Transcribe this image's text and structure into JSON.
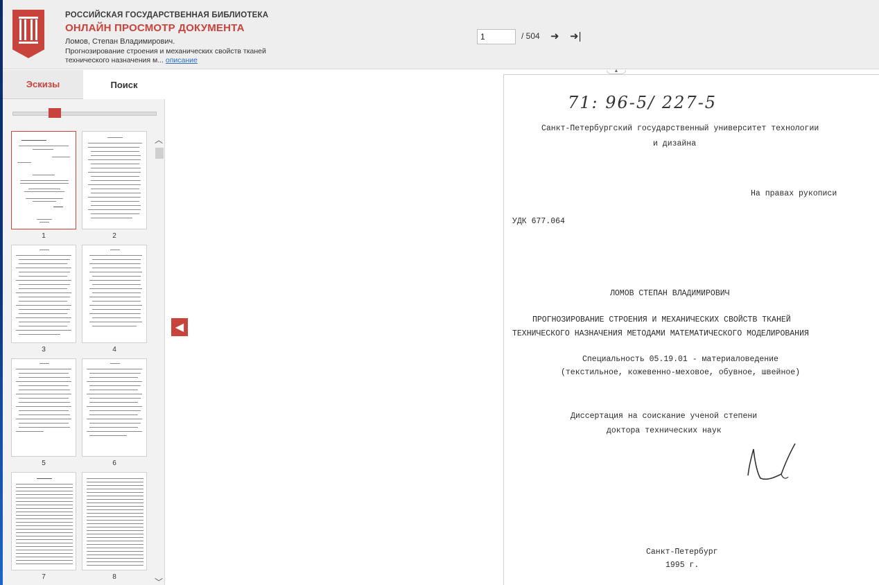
{
  "header": {
    "library_name": "РОССИЙСКАЯ ГОСУДАРСТВЕННАЯ БИБЛИОТЕКА",
    "view_title": "ОНЛАЙН ПРОСМОТР ДОКУМЕНТА",
    "author": "Ломов, Степан Владимирович.",
    "desc_line1": "Прогнозирование строения и механических свойств тканей",
    "desc_line2": "технического назначения м...",
    "desc_link": "описание"
  },
  "pager": {
    "current_page": "1",
    "total": "/ 504",
    "next_icon": "arrow-right-icon",
    "last_icon": "arrow-to-end-icon",
    "next_glyph": "➜",
    "last_glyph": "➜|"
  },
  "sidebar": {
    "tabs": [
      {
        "label": "Эскизы",
        "active": true
      },
      {
        "label": "Поиск",
        "active": false
      }
    ],
    "zoom_level": 0.3,
    "thumbnails": [
      "1",
      "2",
      "3",
      "4",
      "5",
      "6",
      "7",
      "8"
    ]
  },
  "document": {
    "handwritten_code": "71: 96-5/ 227-5",
    "university_line1": "Санкт-Петербургский государственный университет технологии",
    "university_line2": "и дизайна",
    "rights": "На правах рукописи",
    "udk": "УДК 677.064",
    "author_caps": "ЛОМОВ СТЕПАН ВЛАДИМИРОВИЧ",
    "title_line1": "ПРОГНОЗИРОВАНИЕ СТРОЕНИЯ И МЕХАНИЧЕСКИХ СВОЙСТВ ТКАНЕЙ",
    "title_line2": "ТЕХНИЧЕСКОГО НАЗНАЧЕНИЯ МЕТОДАМИ МАТЕМАТИЧЕСКОГО МОДЕЛИРОВАНИЯ",
    "specialty_line1": "Специальность 05.19.01 - материаловедение",
    "specialty_line2": "(текстильное, кожевенно-меховое, обувное, швейное)",
    "dissertation_line1": "Диссертация на соискание ученой степени",
    "dissertation_line2": "доктора технических наук",
    "city": "Санкт-Петербург",
    "year": "1995 г."
  },
  "colors": {
    "accent": "#c8433b",
    "link": "#2b6fc4",
    "header_bg": "#eeeeee"
  }
}
